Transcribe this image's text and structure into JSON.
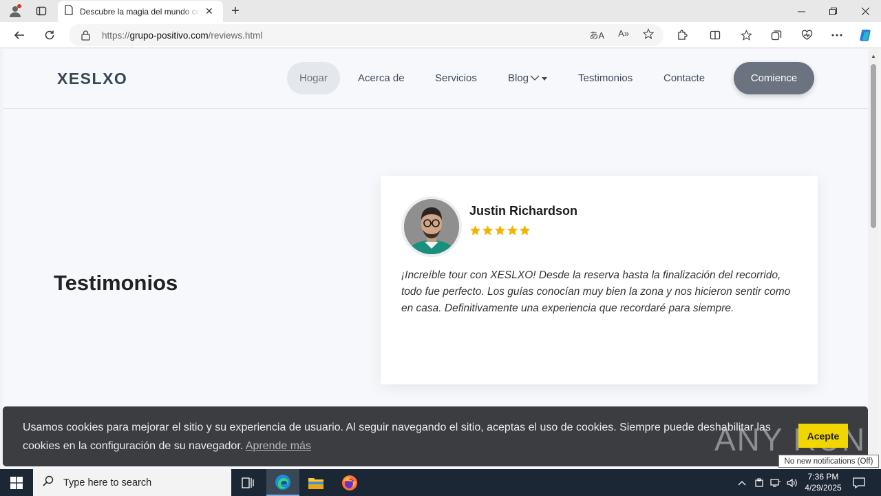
{
  "browser": {
    "tab_title": "Descubre la magia del mundo con XESLXO",
    "url_prefix": "https://",
    "url_host": "grupo-positivo.com",
    "url_path": "/reviews.html"
  },
  "site": {
    "logo": "XESLXO",
    "nav": [
      {
        "label": "Hogar"
      },
      {
        "label": "Acerca de"
      },
      {
        "label": "Servicios"
      },
      {
        "label": "Blog"
      },
      {
        "label": "Testimonios"
      },
      {
        "label": "Contacte"
      }
    ],
    "cta_label": "Comience"
  },
  "section": {
    "title": "Testimonios"
  },
  "review": {
    "name": "Justin Richardson",
    "rating": 5,
    "rating_max": 5,
    "text": " ¡Increíble tour con XESLXO! Desde la reserva hasta la finalización del recorrido, todo fue perfecto. Los guías conocían muy bien la zona y nos hicieron sentir como en casa. Definitivamente una experiencia que recordaré para siempre."
  },
  "cookie_banner": {
    "message": "Usamos cookies para mejorar el sitio y su experiencia de usuario. Al seguir navegando el sitio, aceptas el uso de cookies. Siempre puede deshabilitar las cookies en la configuración de su navegador.",
    "link": "Aprende más",
    "accept": "Acepte"
  },
  "watermark": "ANY RUN",
  "taskbar": {
    "search_placeholder": "Type here to search",
    "time": "7:36 PM",
    "date": "4/29/2025",
    "notification_tooltip": "No new notifications (Off)"
  },
  "colors": {
    "cta_bg": "#6b7380",
    "star": "#f5b301",
    "cookie_bg": "#3b3d40",
    "cookie_btn": "#f1d600",
    "taskbar_bg": "#1c2735"
  }
}
